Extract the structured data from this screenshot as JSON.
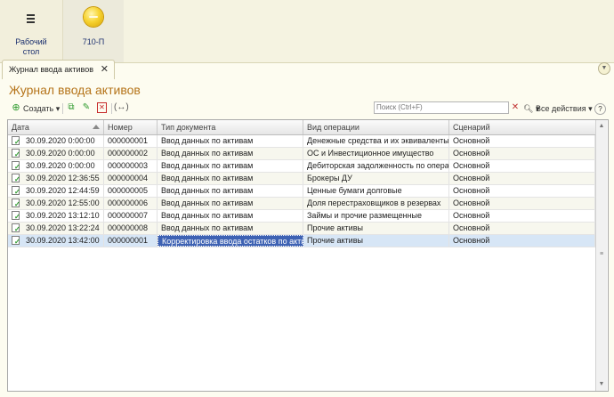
{
  "sections": [
    {
      "label": "Рабочий\nстол",
      "icon": "hamburger-menu-icon"
    },
    {
      "label": "710-П",
      "icon": "coin-icon"
    }
  ],
  "tab": {
    "title": "Журнал ввода активов",
    "close": "✕"
  },
  "page": {
    "title": "Журнал ввода активов"
  },
  "toolbar": {
    "create": "Создать",
    "search_placeholder": "Поиск (Ctrl+F)",
    "all_actions": "Все действия"
  },
  "columns": [
    "Дата",
    "Номер",
    "Тип документа",
    "Вид операции",
    "Сценарий"
  ],
  "rows": [
    {
      "date": "30.09.2020 0:00:00",
      "num": "000000001",
      "type": "Ввод данных по активам",
      "op": "Денежные средства и их эквиваленты",
      "scen": "Основной"
    },
    {
      "date": "30.09.2020 0:00:00",
      "num": "000000002",
      "type": "Ввод данных по активам",
      "op": "ОС и Инвестиционное имущество",
      "scen": "Основной"
    },
    {
      "date": "30.09.2020 0:00:00",
      "num": "000000003",
      "type": "Ввод данных по активам",
      "op": "Дебиторская задолженность по операц...",
      "scen": "Основной"
    },
    {
      "date": "30.09.2020 12:36:55",
      "num": "000000004",
      "type": "Ввод данных по активам",
      "op": "Брокеры ДУ",
      "scen": "Основной"
    },
    {
      "date": "30.09.2020 12:44:59",
      "num": "000000005",
      "type": "Ввод данных по активам",
      "op": "Ценные бумаги долговые",
      "scen": "Основной"
    },
    {
      "date": "30.09.2020 12:55:00",
      "num": "000000006",
      "type": "Ввод данных по активам",
      "op": "Доля перестраховщиков в резервах",
      "scen": "Основной"
    },
    {
      "date": "30.09.2020 13:12:10",
      "num": "000000007",
      "type": "Ввод данных по активам",
      "op": "Займы и прочие размещенные",
      "scen": "Основной"
    },
    {
      "date": "30.09.2020 13:22:24",
      "num": "000000008",
      "type": "Ввод данных по активам",
      "op": "Прочие активы",
      "scen": "Основной"
    },
    {
      "date": "30.09.2020 13:42:00",
      "num": "000000001",
      "type": "Корректировка ввода остатков по акти...",
      "op": "Прочие активы",
      "scen": "Основной"
    }
  ]
}
